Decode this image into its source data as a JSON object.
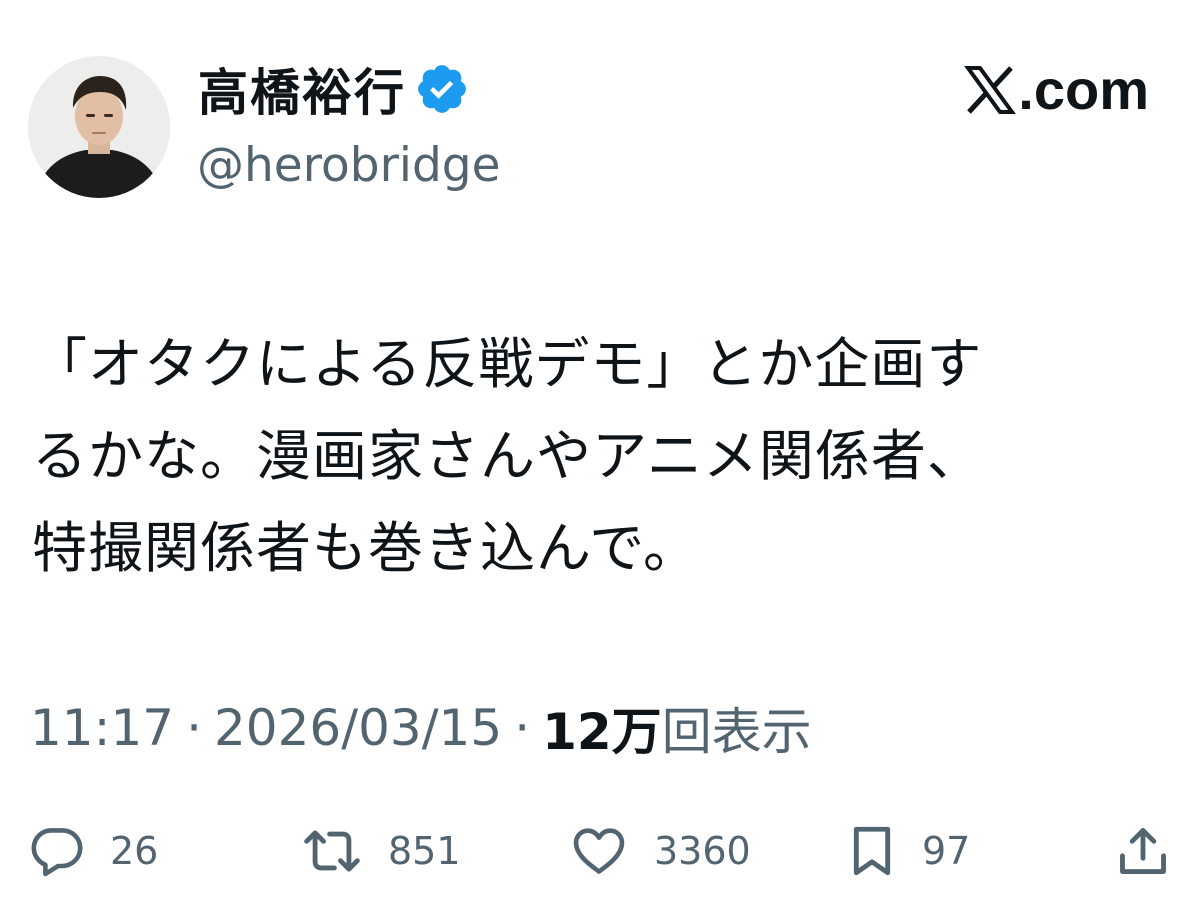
{
  "author": {
    "display_name": "高橋裕行",
    "handle": "@herobridge",
    "verified": true,
    "verified_color": "#1d9bf0"
  },
  "brand": {
    "x_glyph_icon": "x-logo-icon",
    "domain": ".com"
  },
  "tweet": {
    "text": "「オタクによる反戦デモ」とか企画す\nるかな。漫画家さんやアニメ関係者、\n特撮関係者も巻き込んで。"
  },
  "meta": {
    "time": "11:17",
    "separator": "·",
    "date": "2026/03/15",
    "views_count": "12万",
    "views_label": "回表示"
  },
  "actions": {
    "replies": "26",
    "reposts": "851",
    "likes": "3360",
    "bookmarks": "97"
  },
  "colors": {
    "text_primary": "#0f1419",
    "text_secondary": "#536471",
    "accent": "#1d9bf0"
  }
}
